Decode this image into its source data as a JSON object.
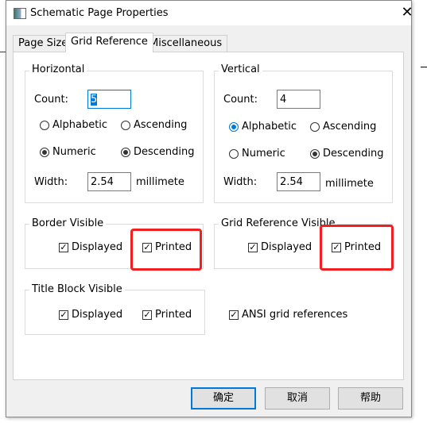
{
  "window": {
    "title": "Schematic Page Properties",
    "close_icon": "close-icon"
  },
  "tabs": [
    {
      "label": "Page Size"
    },
    {
      "label": "Grid Reference",
      "active": true
    },
    {
      "label": "Miscellaneous"
    }
  ],
  "horizontal": {
    "label": "Horizontal",
    "count_label": "Count:",
    "count_value": "5",
    "alphabetic": "Alphabetic",
    "ascending": "Ascending",
    "numeric": "Numeric",
    "descending": "Descending",
    "selected_type": "Numeric",
    "selected_order": "Descending",
    "width_label": "Width:",
    "width_value": "2.54",
    "unit": "millimete"
  },
  "vertical": {
    "label": "Vertical",
    "count_label": "Count:",
    "count_value": "4",
    "alphabetic": "Alphabetic",
    "ascending": "Ascending",
    "numeric": "Numeric",
    "descending": "Descending",
    "selected_type": "Alphabetic",
    "selected_order": "Descending",
    "width_label": "Width:",
    "width_value": "2.54",
    "unit": "millimete"
  },
  "border_visible": {
    "label": "Border Visible",
    "displayed": "Displayed",
    "printed": "Printed",
    "displayed_checked": true,
    "printed_checked": true
  },
  "grid_reference_visible": {
    "label": "Grid Reference Visible",
    "displayed": "Displayed",
    "printed": "Printed",
    "displayed_checked": true,
    "printed_checked": true
  },
  "title_block_visible": {
    "label": "Title Block Visible",
    "displayed": "Displayed",
    "printed": "Printed",
    "displayed_checked": true,
    "printed_checked": true
  },
  "ansi": {
    "label": "ANSI grid references",
    "checked": true
  },
  "buttons": {
    "ok": "确定",
    "cancel": "取消",
    "help": "帮助"
  },
  "colors": {
    "accent": "#0078d7",
    "highlight_box": "#f02020"
  }
}
